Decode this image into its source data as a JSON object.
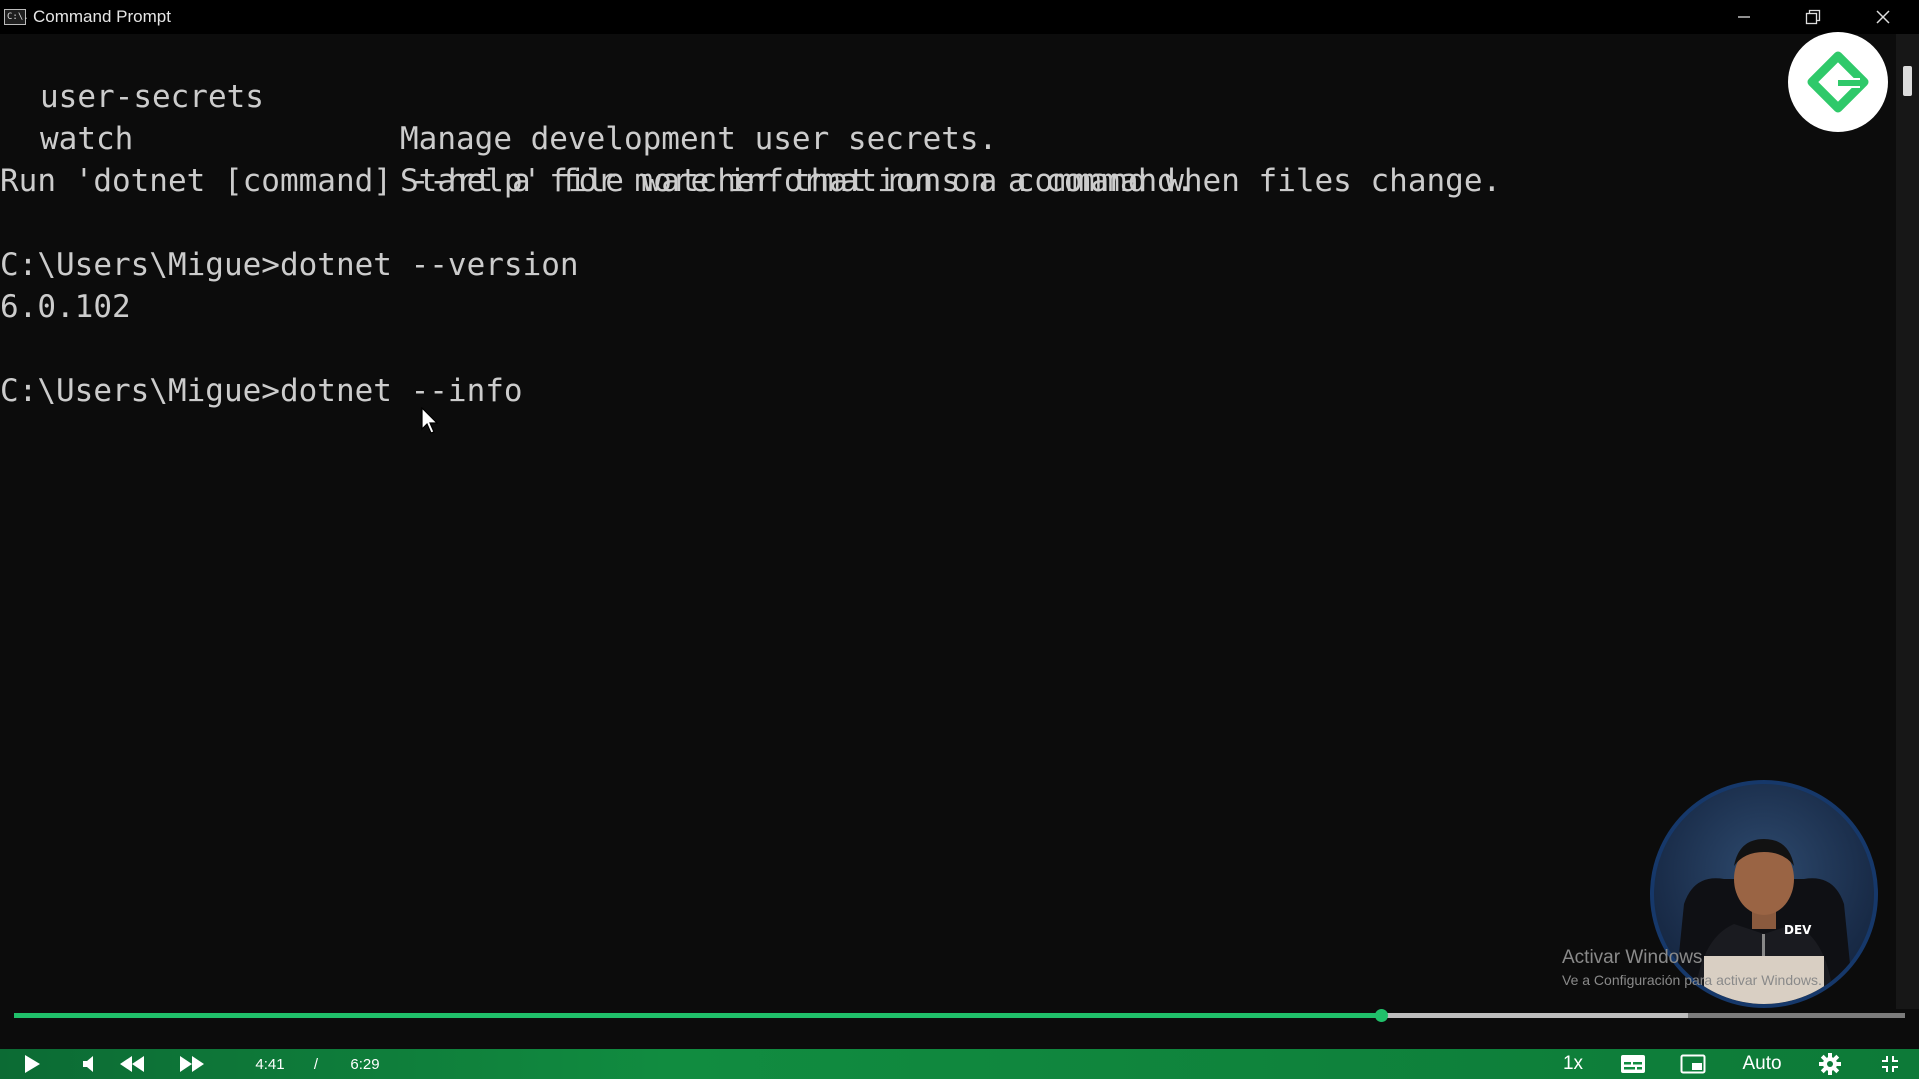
{
  "window": {
    "title": "Command Prompt",
    "icon_label": "C:\\."
  },
  "console": {
    "commands": [
      {
        "name": "user-secrets",
        "description": "Manage development user secrets."
      },
      {
        "name": "watch",
        "description": "Start a file watcher that runs a command when files change."
      }
    ],
    "help_line": "Run 'dotnet [command] --help' for more information on a command.",
    "prompt1": "C:\\Users\\Migue>dotnet --version",
    "output1": "6.0.102",
    "prompt2": "C:\\Users\\Migue>dotnet --info"
  },
  "watermark": {
    "title": "Activar Windows",
    "subtitle": "Ve a Configuración para activar Windows."
  },
  "webcam": {
    "shirt_label": "DEV"
  },
  "player": {
    "current_time": "4:41",
    "separator": "/",
    "duration": "6:29",
    "progress_fraction": 0.723,
    "buffered_fraction": 0.885,
    "speed": "1x",
    "quality": "Auto",
    "accent_color": "#20c06a"
  },
  "icons": [
    "app-icon",
    "minimize-icon",
    "restore-icon",
    "close-icon",
    "play-icon",
    "volume-icon",
    "rewind-icon",
    "fast-forward-icon",
    "subtitles-icon",
    "picture-in-picture-icon",
    "settings-icon",
    "exit-fullscreen-icon",
    "logo-icon"
  ]
}
